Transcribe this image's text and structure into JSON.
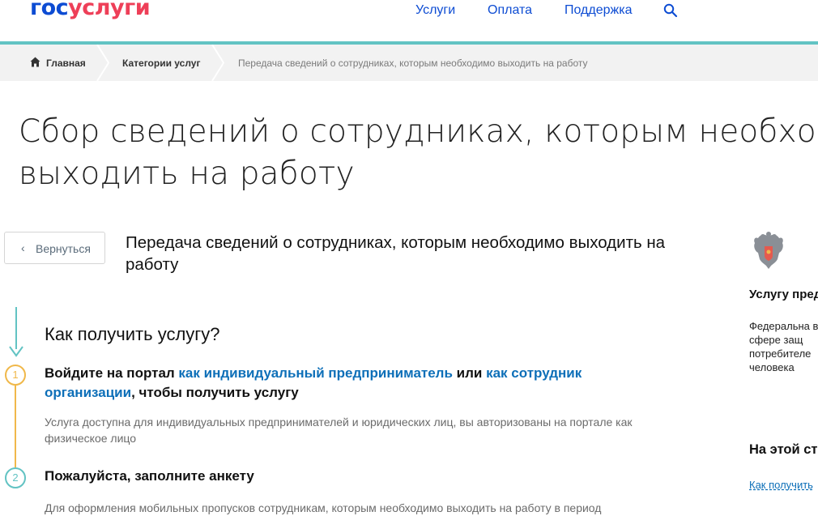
{
  "header": {
    "logo_part1": "гос",
    "logo_part2": "услуги",
    "nav": [
      "Услуги",
      "Оплата",
      "Поддержка"
    ],
    "search_icon": "search-icon"
  },
  "breadcrumb": {
    "home": "Главная",
    "categories": "Категории услуг",
    "current": "Передача сведений о сотрудниках, которым необходимо выходить на работу"
  },
  "page": {
    "title_line1": "Сбор сведений о сотрудниках, которым необходи",
    "title_line2": "выходить на работу",
    "back_label": "Вернуться",
    "service_title": "Передача сведений о сотрудниках, которым необходимо выходить на работу"
  },
  "steps": {
    "heading": "Как получить услугу?",
    "step1": {
      "number": "1",
      "prefix": "Войдите на портал ",
      "link1": "как индивидуальный предприниматель",
      "mid": " или ",
      "link2": "как сотрудник организации",
      "suffix": ", чтобы получить услугу",
      "desc": "Услуга доступна для индивидуальных предпринимателей и юридических лиц, вы авторизованы на портале как физическое лицо"
    },
    "step2": {
      "number": "2",
      "title": "Пожалуйста, заполните анкету",
      "desc": "Для оформления мобильных пропусков сотрудникам, которым необходимо выходить на работу в период"
    }
  },
  "sidebar": {
    "provider_heading": "Услугу пред",
    "provider_text": "Федеральна в сфере защ потребителе человека",
    "onpage_heading": "На этой ст",
    "onpage_link": "Как получить"
  },
  "colors": {
    "brand_blue": "#0d4cd3",
    "brand_red": "#ee3f58",
    "teal": "#62c3c3",
    "step_active": "#f0b84a",
    "link": "#0d6fb8"
  }
}
